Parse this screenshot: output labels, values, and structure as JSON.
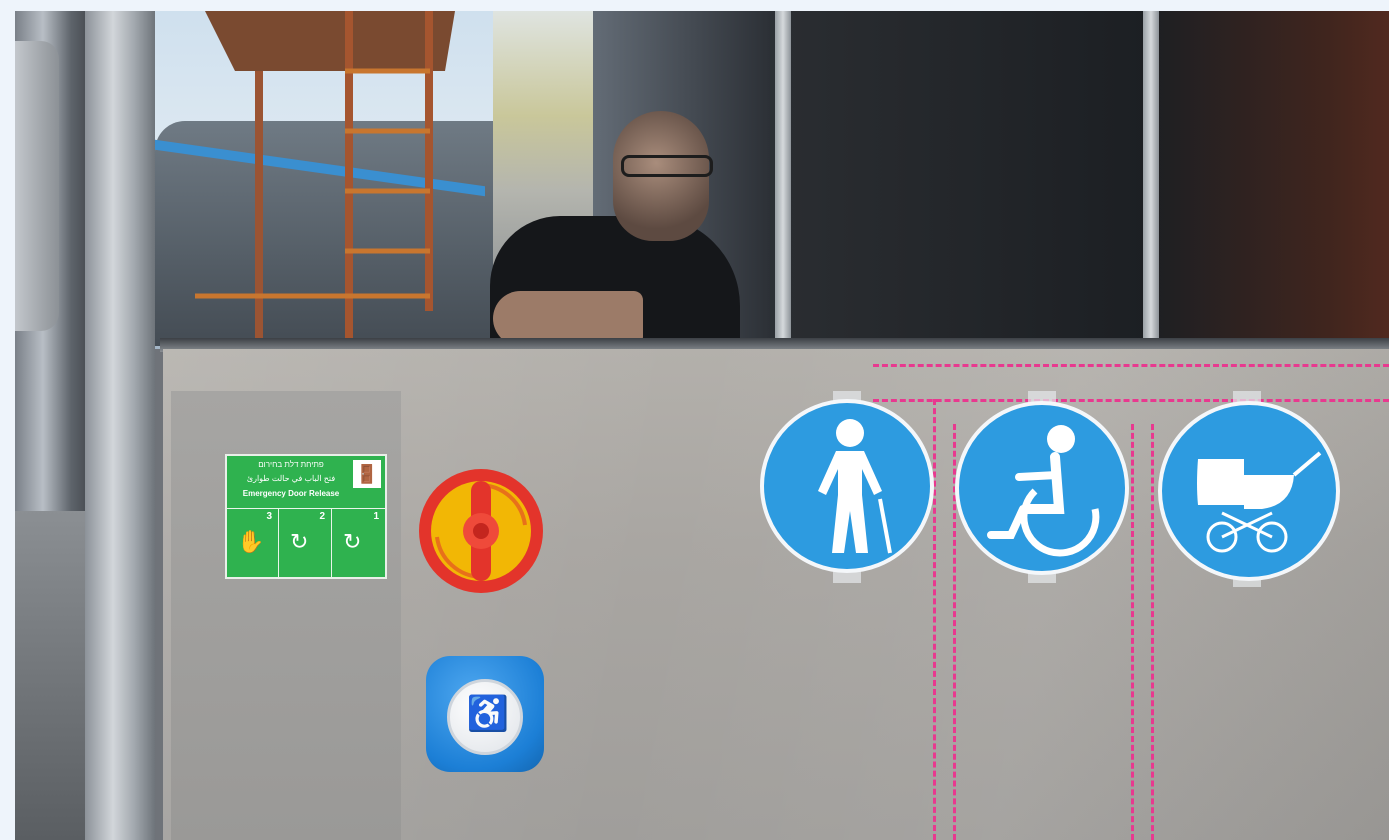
{
  "sticker": {
    "hebrew_text": "פתיחת דלת בחירום",
    "arabic_text": "فتح الباب في حالت طوارئ",
    "english_text": "Emergency Door Release",
    "steps": [
      "3",
      "2",
      "1"
    ]
  },
  "signs": [
    {
      "icon": "elderly-person-with-cane-icon"
    },
    {
      "icon": "wheelchair-icon"
    },
    {
      "icon": "baby-stroller-icon"
    }
  ],
  "colors": {
    "sign_blue": "#2d9be0",
    "sticker_green": "#2fb24f",
    "guide_pink": "#e8398f",
    "knob_red": "#e3342b",
    "knob_yellow": "#f2b705",
    "button_blue": "#1c7fd6"
  }
}
